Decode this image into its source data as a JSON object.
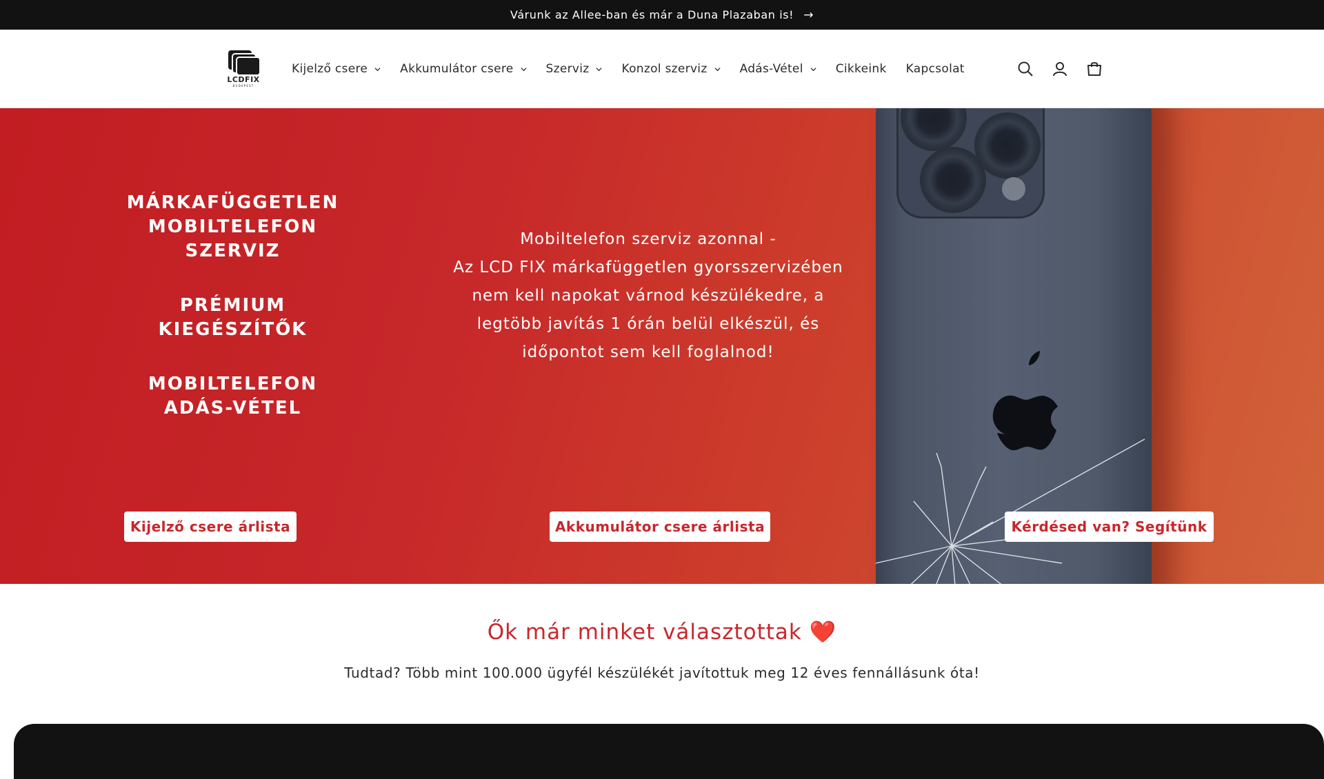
{
  "announcement": {
    "text": "Várunk az Allee-ban és már a Duna Plazaban is!",
    "arrow": "→"
  },
  "logo": {
    "text": "LCDFIX",
    "sub": "BUDAPEST"
  },
  "nav": [
    {
      "label": "Kijelző csere",
      "dropdown": true
    },
    {
      "label": "Akkumulátor csere",
      "dropdown": true
    },
    {
      "label": "Szerviz",
      "dropdown": true
    },
    {
      "label": "Konzol szerviz",
      "dropdown": true
    },
    {
      "label": "Adás-Vétel",
      "dropdown": true
    },
    {
      "label": "Cikkeink",
      "dropdown": false
    },
    {
      "label": "Kapcsolat",
      "dropdown": false
    }
  ],
  "header_icons": [
    "search-icon",
    "account-icon",
    "cart-icon"
  ],
  "hero": {
    "left_blocks": [
      [
        "MÁRKAFÜGGETLEN",
        "MOBILTELEFON",
        "SZERVIZ"
      ],
      [
        "PRÉMIUM",
        "KIEGÉSZÍTŐK"
      ],
      [
        "MOBILTELEFON",
        "ADÁS-VÉTEL"
      ]
    ],
    "center_lines": [
      "Mobiltelefon szerviz azonnal -",
      "Az LCD FIX márkafüggetlen  gyorsszervizében",
      "nem kell napokat várnod készülékedre, a",
      "legtöbb javítás 1 órán belül elkészül, és",
      "időpontot sem kell foglalnod!"
    ],
    "buttons": {
      "display": "Kijelző csere árlista",
      "battery": "Akkumulátor csere árlista",
      "help": "Kérdésed van? Segítünk"
    }
  },
  "section": {
    "title": "Ők már minket választottak ❤️",
    "subtitle": "Tudtad? Több mint 100.000 ügyfél készülékét javítottuk meg 12 éves fennállásunk óta!"
  },
  "colors": {
    "accent": "#c9262b",
    "dark": "#121212",
    "hero_start": "#c11d22",
    "hero_end": "#d2623a"
  }
}
